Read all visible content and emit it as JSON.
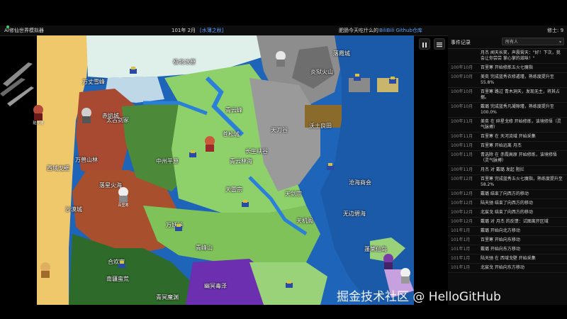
{
  "topbar": {
    "title": "AI修仙世界模拟器",
    "date": "101年 2月",
    "era": "[水薄之秋]",
    "prompt": "肥肠今天吃什么的",
    "links": "BiliBili Github仓库",
    "cultivators": "修士: 9"
  },
  "colors": {
    "ocean": "#1e64b8",
    "desert": "#efc86b",
    "snow": "#dff0ea",
    "grass": "#8ed06a",
    "forest": "#4c8a3a",
    "redrock": "#a84a32",
    "mountain": "#9a9a9a",
    "swamp": "#6b2fb0",
    "field": "#8a6b2b"
  },
  "map": {
    "labels": [
      {
        "text": "极北冰原"
      },
      {
        "text": "炎狱火山"
      },
      {
        "text": "万丈雪峰"
      },
      {
        "text": "落霞城"
      },
      {
        "text": "太古剑冢"
      },
      {
        "text": "青云峰"
      },
      {
        "text": "苍松城"
      },
      {
        "text": "天刀谷"
      },
      {
        "text": "中州平原"
      },
      {
        "text": "沃土良田"
      },
      {
        "text": "西域戈壁"
      },
      {
        "text": "赤焰城"
      },
      {
        "text": "落星火海"
      },
      {
        "text": "万兽山林"
      },
      {
        "text": "天雷宗"
      },
      {
        "text": "长生峡谷"
      },
      {
        "text": "青云林海"
      },
      {
        "text": "天剑宗"
      },
      {
        "text": "天机阁"
      },
      {
        "text": "沧海商会"
      },
      {
        "text": "无边碧海"
      },
      {
        "text": "沙漠城"
      },
      {
        "text": "青峰山"
      },
      {
        "text": "万妖谷"
      },
      {
        "text": "南疆蛮荒"
      },
      {
        "text": "幽冥毒泽"
      },
      {
        "text": "蓬莱仙岛"
      },
      {
        "text": "合欢宗"
      },
      {
        "text": "青冥魔渊"
      }
    ],
    "characters": [
      {
        "name": "陆天驰"
      },
      {
        "name": "百里寒"
      },
      {
        "name": "月杰"
      }
    ]
  },
  "sidebar": {
    "title": "事件记录",
    "filter": "所有人",
    "events": [
      {
        "date": "",
        "text": "月杰 闻天长笑，声震霄天：\"好！下次，我会让你尝尝 掌心掌的滋味！\""
      },
      {
        "date": "100年10月",
        "text": "百里寒 开始修炼五火七魔指"
      },
      {
        "date": "100年10月",
        "text": "美奕 完成蓝秀衣修遁瑾，熟练度提升至55.8%"
      },
      {
        "date": "100年10月",
        "text": "百里寒 路过 青木洞天，发现无主，将其占据。"
      },
      {
        "date": "100年10月",
        "text": "戴璐 完成蓝秀凡凝隙瑾，熟练度提升至100.0%"
      },
      {
        "date": "100年11月",
        "text": "美奕 在 碎星戈修 开始修炼，该境修悟（灵气脉搏）"
      },
      {
        "date": "100年11月",
        "text": "百里寒 在 天河流域 开始采集"
      },
      {
        "date": "100年11月",
        "text": "百里寒 开始远离 月杰"
      },
      {
        "date": "100年11月",
        "text": "青选除 在 赤霞高原 开始修炼，该境修悟（灵气脉搏）"
      },
      {
        "date": "100年11月",
        "text": "月杰 对 戴璐 发起 阻拦"
      },
      {
        "date": "100年12月",
        "text": "百里寒 完成蓝秀五火七魔指，熟练度提升至58.2%"
      },
      {
        "date": "100年12月",
        "text": "戴璐 结束了向西方的移动"
      },
      {
        "date": "100年12月",
        "text": "陆天驰 结束了向西方的移动"
      },
      {
        "date": "100年12月",
        "text": "北宸戈 结束了向西方的移动"
      },
      {
        "date": "100年12月",
        "text": "戴璐 对 月杰 的反馈：试图离开区域"
      },
      {
        "date": "101年1月",
        "text": "戴璐 开始向北方移动"
      },
      {
        "date": "101年1月",
        "text": "百里寒 开始向东移动"
      },
      {
        "date": "101年1月",
        "text": "戴璐 开始向东方移动"
      },
      {
        "date": "101年1月",
        "text": "陆天驰 在 西域戈壁 开始采集"
      },
      {
        "date": "101年1月",
        "text": "北宸戈 开始向东方移动"
      }
    ]
  },
  "watermark": "掘金技术社区 @ HelloGitHub"
}
